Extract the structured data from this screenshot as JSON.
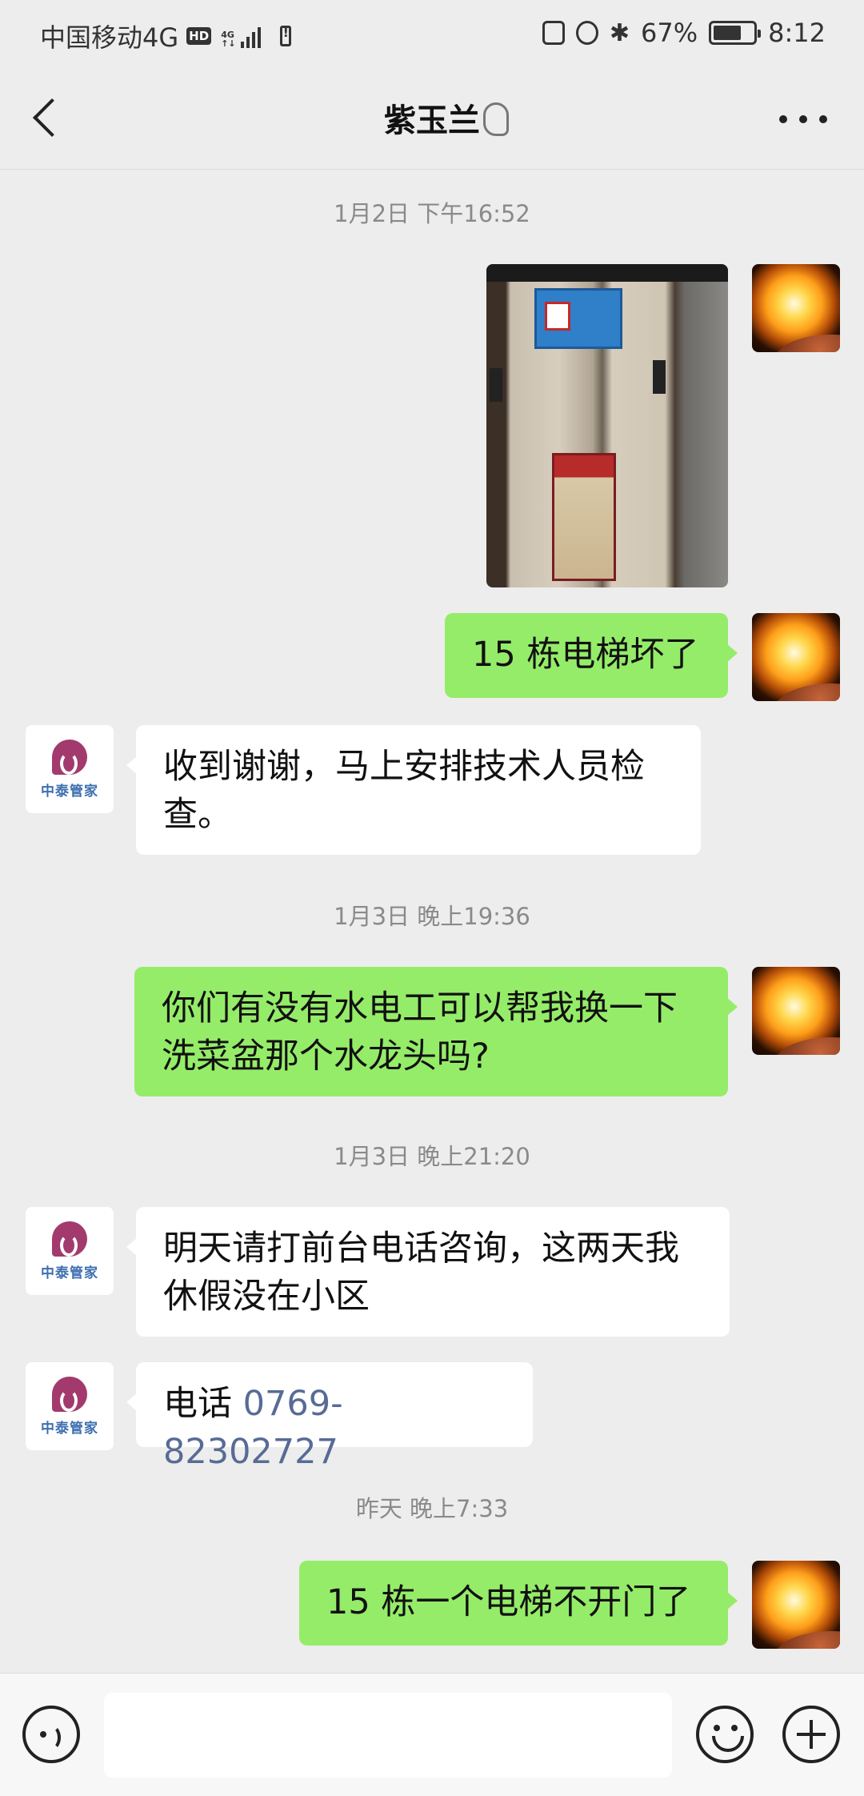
{
  "status_bar": {
    "carrier": "中国移动4G",
    "hd": "HD",
    "battery_percent": "67%",
    "time": "8:12"
  },
  "header": {
    "title": "紫玉兰"
  },
  "contact": {
    "logo_text": "中泰管家"
  },
  "messages": {
    "ts1": "1月2日 下午16:52",
    "m1": "15 栋电梯坏了",
    "m2": "收到谢谢，马上安排技术人员检查。",
    "ts2": "1月3日 晚上19:36",
    "m3": "你们有没有水电工可以帮我换一下洗菜盆那个水龙头吗?",
    "ts3": "1月3日 晚上21:20",
    "m4": "明天请打前台电话咨询，这两天我休假没在小区",
    "m5_prefix": "电话 ",
    "m5_phone": "0769-82302727",
    "ts4": "昨天 晚上7:33",
    "m6": "15 栋一个电梯不开门了"
  },
  "colors": {
    "sent_bubble": "#95ec69",
    "received_bubble": "#ffffff",
    "background": "#ededed",
    "link": "#576b95"
  }
}
